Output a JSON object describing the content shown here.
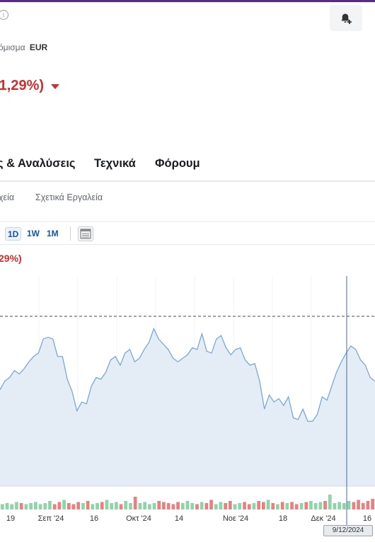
{
  "header": {
    "info_icon": "info-icon",
    "alert_icon": "bell-plus-icon",
    "currency_label": "όμισμα",
    "currency_value": "EUR",
    "change_text": "-1,29%)"
  },
  "tabs": [
    {
      "label": "ς & Αναλύσεις"
    },
    {
      "label": "Τεχνικά"
    },
    {
      "label": "Φόρουμ"
    }
  ],
  "subtabs": [
    {
      "label": "χεία"
    },
    {
      "label": "Σχετικά Εργαλεία"
    }
  ],
  "toolbar": {
    "timeframes": [
      {
        "label": "1D",
        "active": true
      },
      {
        "label": "1W",
        "active": false
      },
      {
        "label": "1M",
        "active": false
      }
    ],
    "chart_type_icon": "candlestick-chart-icon"
  },
  "chart_header": {
    "change_pct": "29%)"
  },
  "crosshair_date": "9/12/2024",
  "chart_data": {
    "type": "area",
    "x_tick_labels": [
      "19",
      "Σεπ '24",
      "16",
      "Οκτ '24",
      "14",
      "Νοε '24",
      "18",
      "Δεκ '24",
      "16"
    ],
    "series": [
      {
        "values": [
          55,
          60,
          62,
          66,
          64,
          67,
          71,
          74,
          76,
          84,
          85,
          84,
          74,
          74,
          61,
          54,
          43,
          48,
          47,
          57,
          62,
          61,
          65,
          72,
          74,
          69,
          76,
          78,
          71,
          73,
          78,
          82,
          90,
          84,
          81,
          78,
          73,
          71,
          73,
          75,
          79,
          78,
          87,
          77,
          76,
          84,
          86,
          79,
          75,
          78,
          79,
          72,
          69,
          70,
          60,
          44,
          52,
          48,
          50,
          46,
          51,
          39,
          38,
          44,
          37,
          37,
          41,
          51,
          49,
          57,
          65,
          71,
          76,
          80,
          78,
          72,
          69,
          62,
          60
        ]
      },
      {
        "name": "volume",
        "values": [
          5,
          6,
          5,
          7,
          6,
          5,
          6,
          7,
          5,
          6,
          8,
          5,
          7,
          9,
          6,
          5,
          7,
          6,
          8,
          5,
          6,
          7,
          9,
          6,
          7,
          5,
          8,
          6,
          12,
          6,
          7,
          5,
          6,
          8,
          7,
          6,
          5,
          7,
          6,
          8,
          6,
          5,
          7,
          6,
          9,
          5,
          7,
          6,
          8,
          5,
          6,
          7,
          5,
          6,
          8,
          7,
          9,
          6,
          5,
          7,
          6,
          7,
          5,
          6,
          7,
          8,
          6,
          7,
          8,
          14,
          6,
          7,
          6,
          8,
          7,
          9,
          6,
          8,
          10
        ]
      }
    ],
    "reference_line": "dashed-previous-close",
    "crosshair": "vertical",
    "grid": false
  }
}
